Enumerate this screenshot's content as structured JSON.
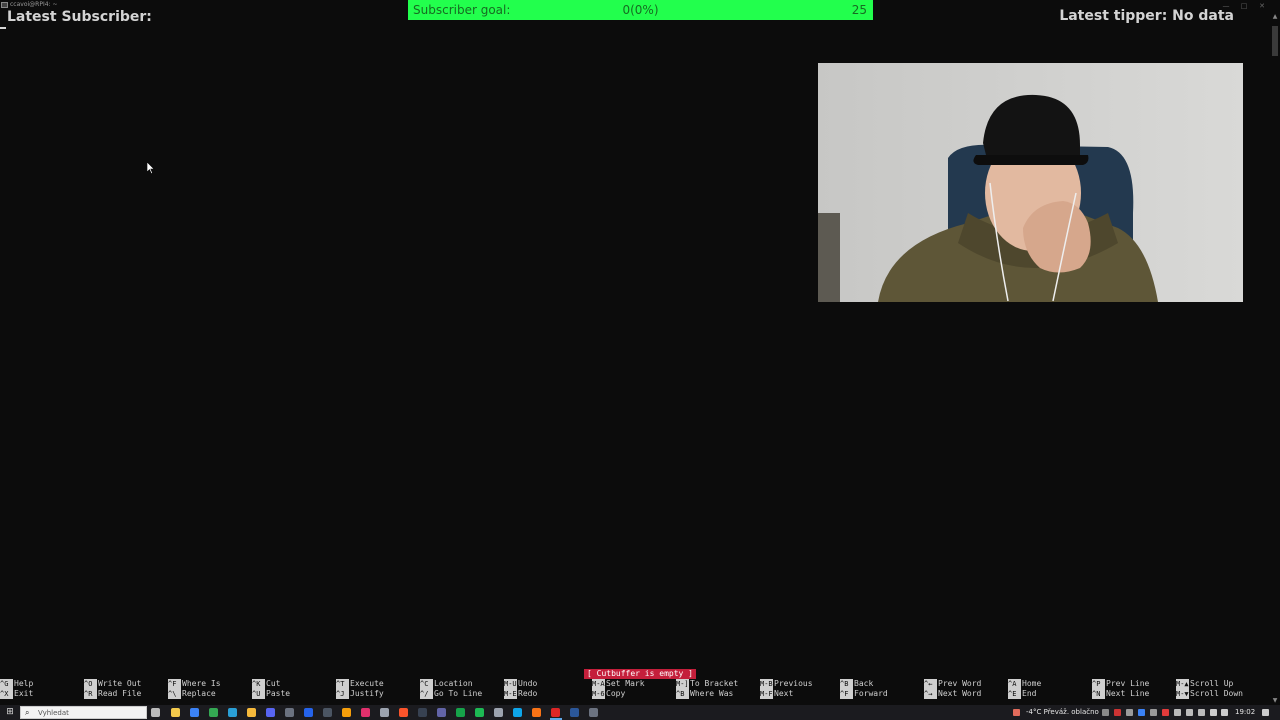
{
  "window": {
    "title": "ccavoi@RPI4: ~",
    "minimize_glyph": "—",
    "maximize_glyph": "□",
    "close_glyph": "✕"
  },
  "overlay": {
    "latest_subscriber": "Latest Subscriber:",
    "latest_tipper": "Latest tipper: No data"
  },
  "goal": {
    "label": "Subscriber goal:",
    "progress": "0(0%)",
    "target": "25",
    "progress_fraction": 0,
    "color": "#22ff4d"
  },
  "nano": {
    "status": "[ Cutbuffer is empty ]",
    "shortcuts": [
      {
        "key1": "^G",
        "label1": "Help",
        "key2": "^X",
        "label2": "Exit"
      },
      {
        "key1": "^O",
        "label1": "Write Out",
        "key2": "^R",
        "label2": "Read File"
      },
      {
        "key1": "^F",
        "label1": "Where Is",
        "key2": "^\\",
        "label2": "Replace"
      },
      {
        "key1": "^K",
        "label1": "Cut",
        "key2": "^U",
        "label2": "Paste"
      },
      {
        "key1": "^T",
        "label1": "Execute",
        "key2": "^J",
        "label2": "Justify"
      },
      {
        "key1": "^C",
        "label1": "Location",
        "key2": "^/",
        "label2": "Go To Line"
      },
      {
        "key1": "M-U",
        "label1": "Undo",
        "key2": "M-E",
        "label2": "Redo"
      },
      {
        "key1": "M-A",
        "label1": "Set Mark",
        "key2": "M-6",
        "label2": "Copy"
      },
      {
        "key1": "M-]",
        "label1": "To Bracket",
        "key2": "^B",
        "label2": "Where Was"
      },
      {
        "key1": "M-B",
        "label1": "Previous",
        "key2": "M-F",
        "label2": "Next"
      },
      {
        "key1": "^B",
        "label1": "Back",
        "key2": "^F",
        "label2": "Forward"
      },
      {
        "key1": "^←",
        "label1": "Prev Word",
        "key2": "^→",
        "label2": "Next Word"
      },
      {
        "key1": "^A",
        "label1": "Home",
        "key2": "^E",
        "label2": "End"
      },
      {
        "key1": "^P",
        "label1": "Prev Line",
        "key2": "^N",
        "label2": "Next Line"
      },
      {
        "key1": "M-▲",
        "label1": "Scroll Up",
        "key2": "M-▼",
        "label2": "Scroll Down"
      }
    ]
  },
  "taskbar": {
    "search_placeholder": "Vyhledat",
    "weather": "-4°C  Převáž. oblačno",
    "time": "19:02",
    "apps": [
      {
        "name": "task-view-icon",
        "color": "#bbbbbb"
      },
      {
        "name": "file-explorer-icon",
        "color": "#f2c94c"
      },
      {
        "name": "store-icon",
        "color": "#3b82f6"
      },
      {
        "name": "chrome-icon",
        "color": "#34a853"
      },
      {
        "name": "vscode-icon",
        "color": "#2a9fd6"
      },
      {
        "name": "folder-icon",
        "color": "#f6b93b"
      },
      {
        "name": "discord-icon",
        "color": "#5865f2"
      },
      {
        "name": "obs-icon",
        "color": "#6b7280"
      },
      {
        "name": "outlook-icon",
        "color": "#2563eb"
      },
      {
        "name": "terminal-app-icon",
        "color": "#4b5563"
      },
      {
        "name": "vlc-icon",
        "color": "#f59e0b"
      },
      {
        "name": "instagram-icon",
        "color": "#e1306c"
      },
      {
        "name": "notes-icon",
        "color": "#9ca3af"
      },
      {
        "name": "brave-icon",
        "color": "#fb542b"
      },
      {
        "name": "unity-icon",
        "color": "#374151"
      },
      {
        "name": "teams-icon",
        "color": "#6264a7"
      },
      {
        "name": "excel-icon",
        "color": "#16a34a"
      },
      {
        "name": "spotify-icon",
        "color": "#1db954"
      },
      {
        "name": "settings-icon",
        "color": "#9ca3af"
      },
      {
        "name": "edge-icon",
        "color": "#0ea5e9"
      },
      {
        "name": "firefox-icon",
        "color": "#f97316"
      },
      {
        "name": "pdf-icon",
        "color": "#dc2626"
      },
      {
        "name": "word-icon",
        "color": "#2b579a"
      },
      {
        "name": "windows-terminal-icon",
        "color": "#6b7280"
      }
    ]
  }
}
